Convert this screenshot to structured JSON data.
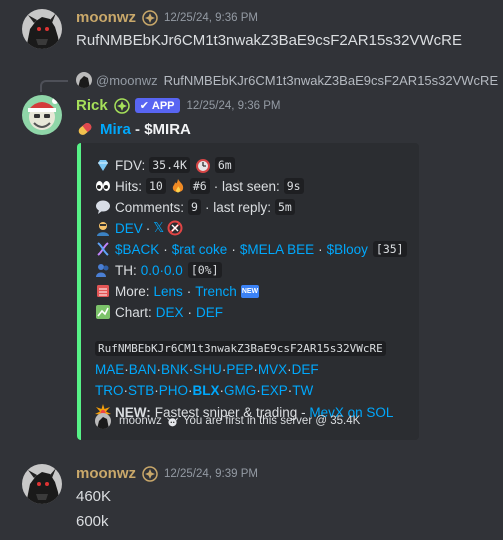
{
  "messages": [
    {
      "author": "moonwz",
      "time": "12/25/24, 9:36 PM",
      "text": "RufNMBEbKJr6CM1t3nwakZ3BaE9csF2AR15s32VWcRE"
    },
    {
      "reply": {
        "author": "@moonwz",
        "text": "RufNMBEbKJr6CM1t3nwakZ3BaE9csF2AR15s32VWcRE"
      },
      "author": "Rick",
      "badge": "APP",
      "time": "12/25/24, 9:36 PM",
      "title_name": "Mira",
      "title_dash": " - ",
      "title_ticker": "$MIRA",
      "embed": {
        "fdv_label": "FDV:",
        "fdv_value": "35.4K",
        "age_value": "6m",
        "hits_label": "Hits:",
        "hits_value": "10",
        "hits_rank": "#6",
        "last_seen_label": "· last seen:",
        "last_seen_value": "9s",
        "comments_label": "Comments:",
        "comments_value": "9",
        "last_reply_label": "· last reply:",
        "last_reply_value": "5m",
        "dev_label": "DEV",
        "dev_sep": "·",
        "x_label": "𝕏",
        "links": [
          "$BACK",
          "$rat coke",
          "$MELA BEE",
          "$Blooy"
        ],
        "links_count": "[35]",
        "th_label": "TH:",
        "th_value": "0.0",
        "th_value2": "0.0",
        "th_pct": "[0%]",
        "more_label": "More:",
        "more_lens": "Lens",
        "more_trench": "Trench",
        "new_badge": "NEW",
        "chart_label": "Chart:",
        "chart_dex": "DEX",
        "chart_def": "DEF",
        "address": "RufNMBEbKJr6CM1t3nwakZ3BaE9csF2AR15s32VWcRE",
        "platforms_row1": [
          "MAE",
          "BAN",
          "BNK",
          "SHU",
          "PEP",
          "MVX",
          "DEF"
        ],
        "platforms_row2": [
          "TRO",
          "STB",
          "PHO",
          "BLX",
          "GMG",
          "EXP",
          "TW"
        ],
        "new_label": "NEW:",
        "new_text": "Fastest sniper & trading - ",
        "new_link": "MevX on SOL",
        "footer_user": "moonwz",
        "footer_text": "You are first in this server @ 35.4K"
      }
    },
    {
      "author": "moonwz",
      "time": "12/25/24, 9:39 PM",
      "lines": [
        "460K",
        "600k"
      ]
    }
  ],
  "colors": {
    "background": "#313338",
    "embed_bg": "#2b2d31",
    "embed_border": "#57f287",
    "link": "#00a8fc",
    "username_moonwz": "#c9a86a",
    "username_rick": "#a6e05a",
    "app_badge": "#5865f2"
  }
}
